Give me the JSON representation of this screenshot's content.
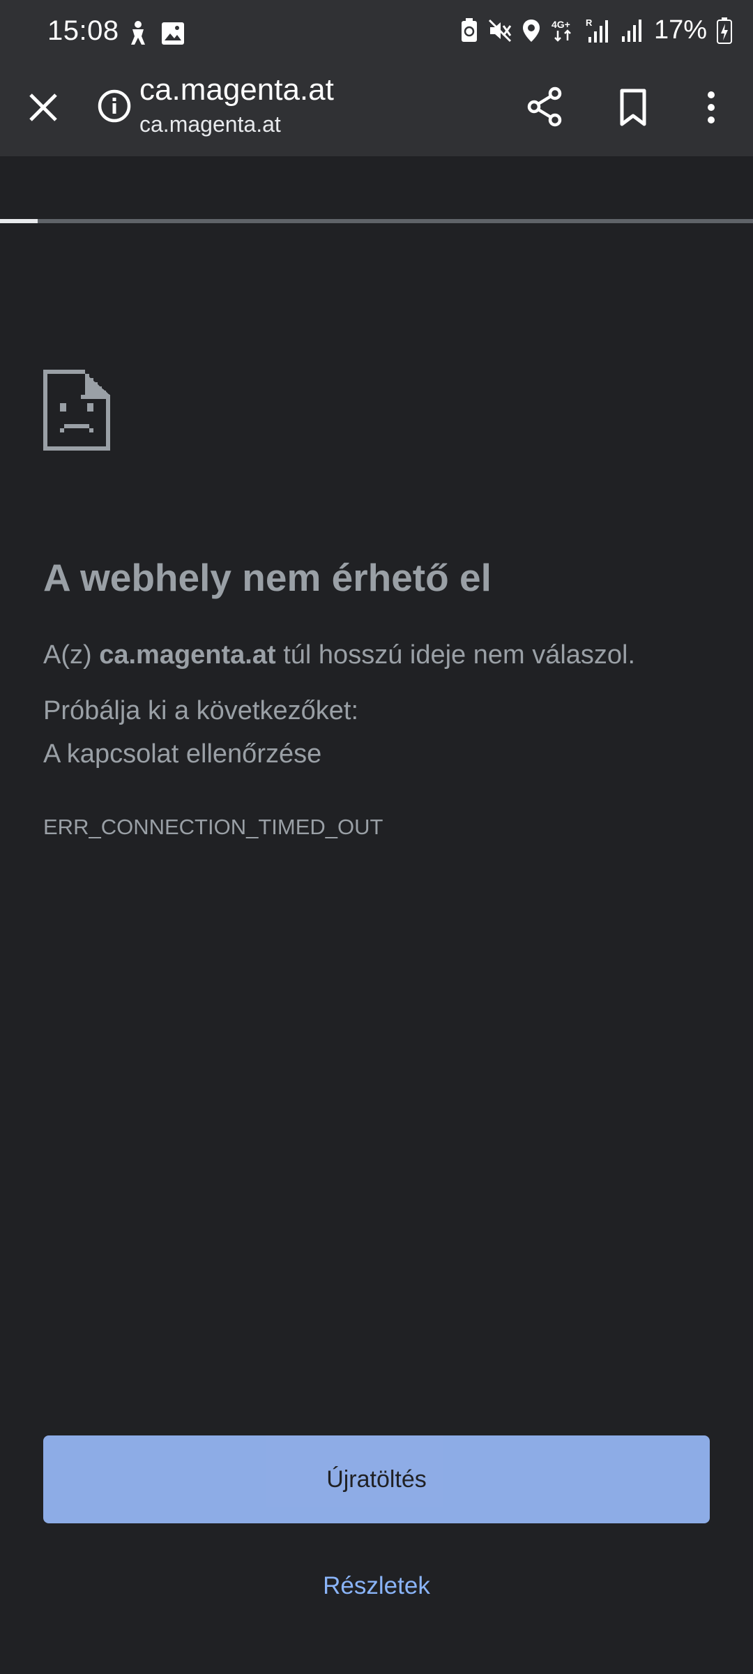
{
  "status_bar": {
    "time": "15:08",
    "battery": "17%",
    "icons_left": [
      "accessibility-icon",
      "gallery-icon"
    ],
    "icons_right": [
      "battery-saver-icon",
      "mute-icon",
      "location-icon",
      "network-4g-icon",
      "signal-icon",
      "signal-icon-2",
      "battery-charging-icon"
    ]
  },
  "toolbar": {
    "url_title": "ca.magenta.at",
    "url_subtitle": "ca.magenta.at",
    "progress": 0.05
  },
  "error_page": {
    "title": "A webhely nem érhető el",
    "message_prefix": "A(z) ",
    "message_host": "ca.magenta.at",
    "message_suffix": " túl hosszú ideje nem válaszol.",
    "suggestions_header": "Próbálja ki a következőket:",
    "suggestion_1": "A kapcsolat ellenőrzése",
    "error_code": "ERR_CONNECTION_TIMED_OUT",
    "reload_label": "Újratöltés",
    "details_label": "Részletek"
  },
  "colors": {
    "background": "#202124",
    "toolbar": "#303134",
    "accent": "#8ab4f8",
    "text": "#9aa0a6"
  }
}
